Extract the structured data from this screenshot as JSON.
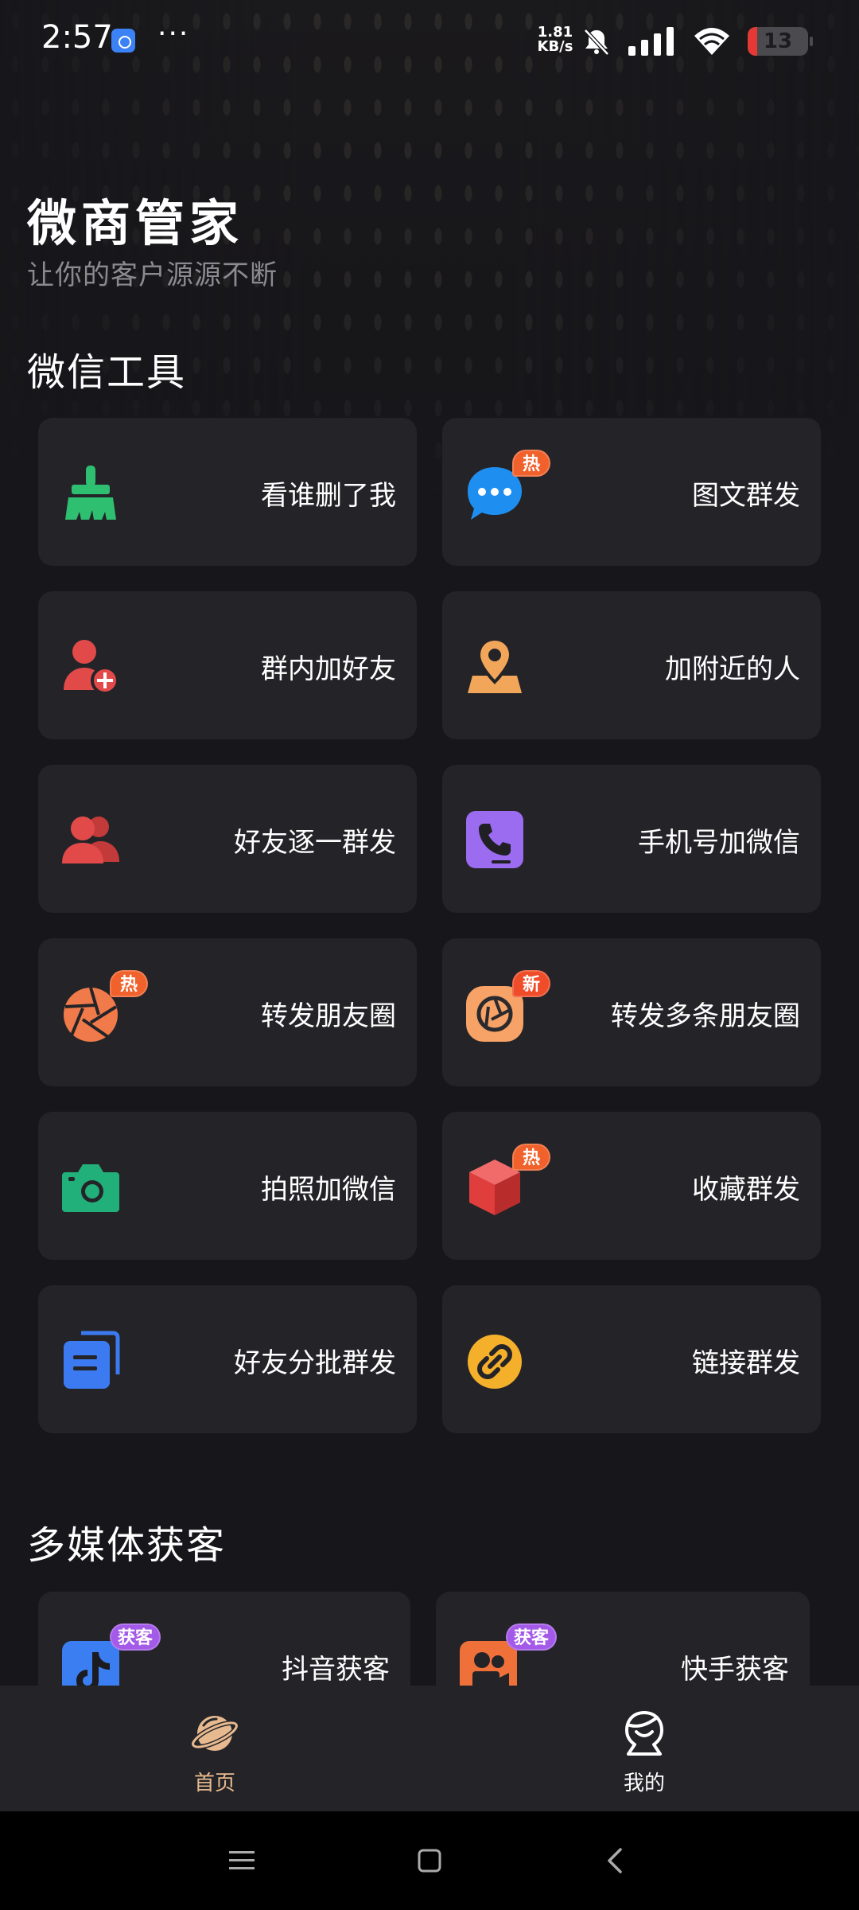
{
  "status_bar": {
    "time": "2:57",
    "more": "···",
    "net_speed_value": "1.81",
    "net_speed_unit": "KB/s",
    "battery": "13"
  },
  "header": {
    "title": "微商管家",
    "subtitle": "让你的客户源源不断"
  },
  "sections": {
    "wechat_tools": {
      "title": "微信工具",
      "items": [
        {
          "label": "看谁删了我",
          "icon": "broom-icon",
          "badge": ""
        },
        {
          "label": "图文群发",
          "icon": "chat-bubble-icon",
          "badge": "热"
        },
        {
          "label": "群内加好友",
          "icon": "add-user-icon",
          "badge": ""
        },
        {
          "label": "加附近的人",
          "icon": "location-pin-icon",
          "badge": ""
        },
        {
          "label": "好友逐一群发",
          "icon": "users-icon",
          "badge": ""
        },
        {
          "label": "手机号加微信",
          "icon": "phone-icon",
          "badge": ""
        },
        {
          "label": "转发朋友圈",
          "icon": "aperture-icon",
          "badge": "热"
        },
        {
          "label": "转发多条朋友圈",
          "icon": "aperture-circle-icon",
          "badge": "新"
        },
        {
          "label": "拍照加微信",
          "icon": "camera-icon",
          "badge": ""
        },
        {
          "label": "收藏群发",
          "icon": "cube-icon",
          "badge": "热"
        },
        {
          "label": "好友分批群发",
          "icon": "document-stack-icon",
          "badge": ""
        },
        {
          "label": "链接群发",
          "icon": "link-icon",
          "badge": ""
        }
      ]
    },
    "multimedia": {
      "title": "多媒体获客",
      "items": [
        {
          "label": "抖音获客",
          "icon": "douyin-icon",
          "badge": "获客"
        },
        {
          "label": "快手获客",
          "icon": "kuaishou-icon",
          "badge": "获客"
        }
      ]
    }
  },
  "bottom_nav": {
    "home_label": "首页",
    "mine_label": "我的"
  },
  "colors": {
    "background": "#17171b",
    "card": "#242428",
    "accent_nav": "#e7b98f",
    "badge_hot": "#f0612b",
    "badge_get": "#a35ae8"
  }
}
